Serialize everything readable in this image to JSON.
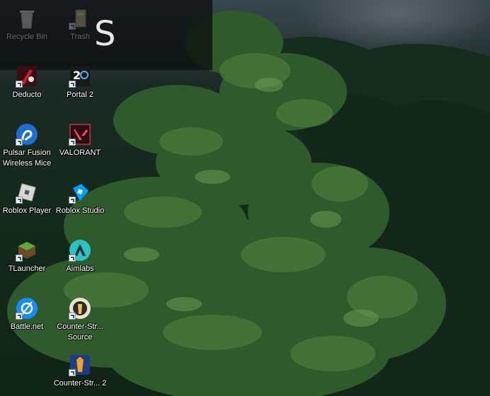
{
  "search_overlay": {
    "typed_text": "S"
  },
  "desktop_icons": [
    {
      "label": "Recycle Bin",
      "icon": "recycle-bin-icon"
    },
    {
      "label": "Trash",
      "icon": "trash-icon"
    },
    {
      "label": "Deducto",
      "icon": "deducto-icon"
    },
    {
      "label": "Portal 2",
      "icon": "portal-2-icon"
    },
    {
      "label": "Pulsar Fusion Wireless Mice",
      "icon": "pulsar-fusion-icon"
    },
    {
      "label": "VALORANT",
      "icon": "valorant-icon"
    },
    {
      "label": "Roblox Player",
      "icon": "roblox-player-icon"
    },
    {
      "label": "Roblox Studio",
      "icon": "roblox-studio-icon"
    },
    {
      "label": "TLauncher",
      "icon": "tlauncher-icon"
    },
    {
      "label": "Aimlabs",
      "icon": "aimlabs-icon"
    },
    {
      "label": "Battle.net",
      "icon": "battle-net-icon"
    },
    {
      "label": "Counter-Str... Source",
      "icon": "counter-strike-source-icon"
    },
    {
      "label": "Counter-Str... 2",
      "icon": "counter-strike-2-icon"
    }
  ]
}
